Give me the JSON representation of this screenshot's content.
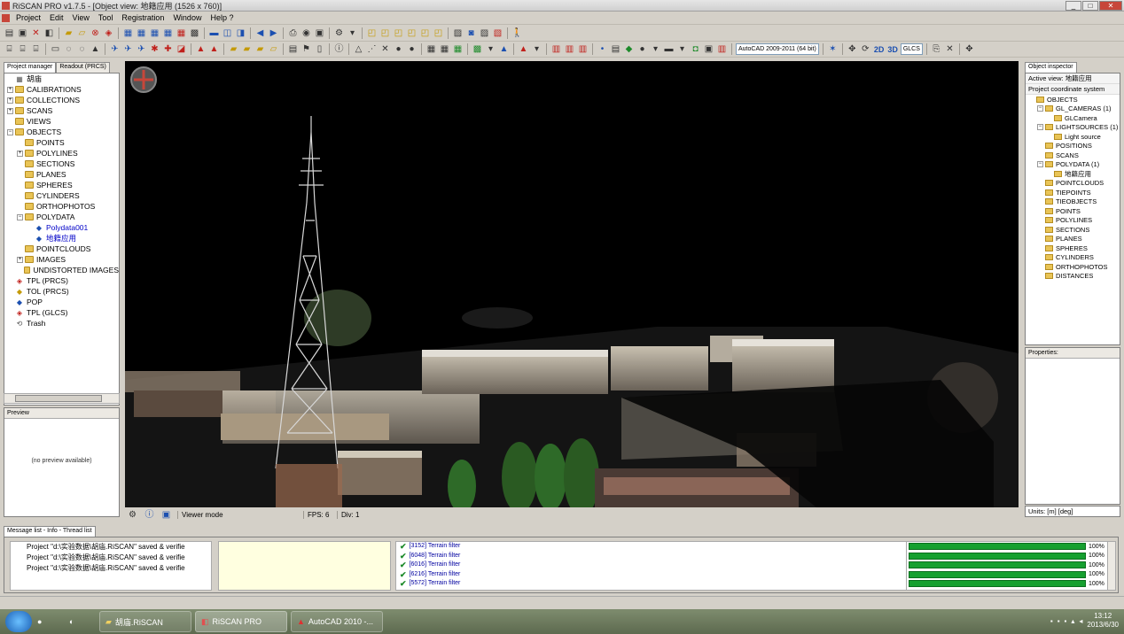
{
  "window": {
    "title": "RiSCAN PRO v1.7.5 - [Object view: 地籍应用 (1526 x 760)]"
  },
  "menu": [
    "Project",
    "Edit",
    "View",
    "Tool",
    "Registration",
    "Window",
    "Help ?"
  ],
  "toolbar2": {
    "dxf_combo": "AutoCAD 2009-2011 (64 bit)",
    "view_2d": "2D",
    "view_3d": "3D",
    "coord_combo": "GLCS"
  },
  "left_panel": {
    "tabs": [
      "Project manager",
      "Readout (PRCS)"
    ],
    "tree": [
      {
        "label": "胡庙",
        "level": 0,
        "exp": "",
        "icon": "root"
      },
      {
        "label": "CALIBRATIONS",
        "level": 0,
        "exp": "+",
        "icon": "folder"
      },
      {
        "label": "COLLECTIONS",
        "level": 0,
        "exp": "+",
        "icon": "folder"
      },
      {
        "label": "SCANS",
        "level": 0,
        "exp": "+",
        "icon": "folder"
      },
      {
        "label": "VIEWS",
        "level": 0,
        "exp": "",
        "icon": "folder"
      },
      {
        "label": "OBJECTS",
        "level": 0,
        "exp": "−",
        "icon": "folder"
      },
      {
        "label": "POINTS",
        "level": 1,
        "exp": "",
        "icon": "folder"
      },
      {
        "label": "POLYLINES",
        "level": 1,
        "exp": "+",
        "icon": "folder"
      },
      {
        "label": "SECTIONS",
        "level": 1,
        "exp": "",
        "icon": "folder"
      },
      {
        "label": "PLANES",
        "level": 1,
        "exp": "",
        "icon": "folder"
      },
      {
        "label": "SPHERES",
        "level": 1,
        "exp": "",
        "icon": "folder"
      },
      {
        "label": "CYLINDERS",
        "level": 1,
        "exp": "",
        "icon": "folder"
      },
      {
        "label": "ORTHOPHOTOS",
        "level": 1,
        "exp": "",
        "icon": "folder"
      },
      {
        "label": "POLYDATA",
        "level": 1,
        "exp": "−",
        "icon": "folder"
      },
      {
        "label": "Polydata001",
        "level": 2,
        "exp": "",
        "icon": "mesh",
        "selected": true
      },
      {
        "label": "地籍应用",
        "level": 2,
        "exp": "",
        "icon": "mesh",
        "selected": true
      },
      {
        "label": "POINTCLOUDS",
        "level": 1,
        "exp": "",
        "icon": "folder"
      },
      {
        "label": "IMAGES",
        "level": 1,
        "exp": "+",
        "icon": "folder"
      },
      {
        "label": "UNDISTORTED IMAGES",
        "level": 1,
        "exp": "",
        "icon": "folder"
      },
      {
        "label": "TPL (PRCS)",
        "level": 0,
        "exp": "",
        "icon": "tpl"
      },
      {
        "label": "TOL (PRCS)",
        "level": 0,
        "exp": "",
        "icon": "tol"
      },
      {
        "label": "POP",
        "level": 0,
        "exp": "",
        "icon": "pop"
      },
      {
        "label": "TPL (GLCS)",
        "level": 0,
        "exp": "",
        "icon": "tpl"
      },
      {
        "label": "Trash",
        "level": 0,
        "exp": "",
        "icon": "trash"
      }
    ],
    "preview_title": "Preview",
    "preview_text": "(no preview available)"
  },
  "viewport_status": {
    "mode": "Viewer mode",
    "fps": "FPS: 6",
    "div": "Div: 1"
  },
  "right_panel": {
    "tab": "Object inspector",
    "active_view": "Active view: 地籍应用",
    "coord_system": "Project coordinate system",
    "tree": [
      {
        "label": "OBJECTS",
        "level": 0,
        "exp": ""
      },
      {
        "label": "GL_CAMERAS (1)",
        "level": 1,
        "exp": "−"
      },
      {
        "label": "GLCamera",
        "level": 2,
        "exp": ""
      },
      {
        "label": "LIGHTSOURCES (1)",
        "level": 1,
        "exp": "−"
      },
      {
        "label": "Light source",
        "level": 2,
        "exp": ""
      },
      {
        "label": "POSITIONS",
        "level": 1,
        "exp": ""
      },
      {
        "label": "SCANS",
        "level": 1,
        "exp": ""
      },
      {
        "label": "POLYDATA (1)",
        "level": 1,
        "exp": "−"
      },
      {
        "label": "地籍应用",
        "level": 2,
        "exp": ""
      },
      {
        "label": "POINTCLOUDS",
        "level": 1,
        "exp": ""
      },
      {
        "label": "TIEPOINTS",
        "level": 1,
        "exp": ""
      },
      {
        "label": "TIEOBJECTS",
        "level": 1,
        "exp": ""
      },
      {
        "label": "POINTS",
        "level": 1,
        "exp": ""
      },
      {
        "label": "POLYLINES",
        "level": 1,
        "exp": ""
      },
      {
        "label": "SECTIONS",
        "level": 1,
        "exp": ""
      },
      {
        "label": "PLANES",
        "level": 1,
        "exp": ""
      },
      {
        "label": "SPHERES",
        "level": 1,
        "exp": ""
      },
      {
        "label": "CYLINDERS",
        "level": 1,
        "exp": ""
      },
      {
        "label": "ORTHOPHOTOS",
        "level": 1,
        "exp": ""
      },
      {
        "label": "DISTANCES",
        "level": 1,
        "exp": ""
      }
    ],
    "properties_title": "Properties:",
    "units": "Units: [m] [deg]"
  },
  "bottom": {
    "tabs": "Message list - Info - Thread list",
    "messages": [
      "Project \"d:\\实验数据\\胡庙.RiSCAN\" saved & verifie",
      "Project \"d:\\实验数据\\胡庙.RiSCAN\" saved & verifie",
      "Project \"d:\\实验数据\\胡庙.RiSCAN\" saved & verifie"
    ],
    "threads": [
      "[3152] Terrain filter",
      "[6048] Terrain filter",
      "[6016] Terrain filter",
      "[6216] Terrain filter",
      "[5572] Terrain filter"
    ],
    "progress": [
      1.0,
      1.0,
      1.0,
      1.0,
      1.0
    ],
    "progress_labels": [
      "100%",
      "100%",
      "100%",
      "100%",
      "100%"
    ]
  },
  "taskbar": {
    "tasks": [
      "胡庙.RiSCAN",
      "RiSCAN PRO",
      "AutoCAD 2010 -..."
    ],
    "time": "13:12",
    "date": "2013/6/30"
  },
  "colors": {
    "viewport_bg": "#000000",
    "progress": "#16a030",
    "selection": "#0000c8"
  }
}
